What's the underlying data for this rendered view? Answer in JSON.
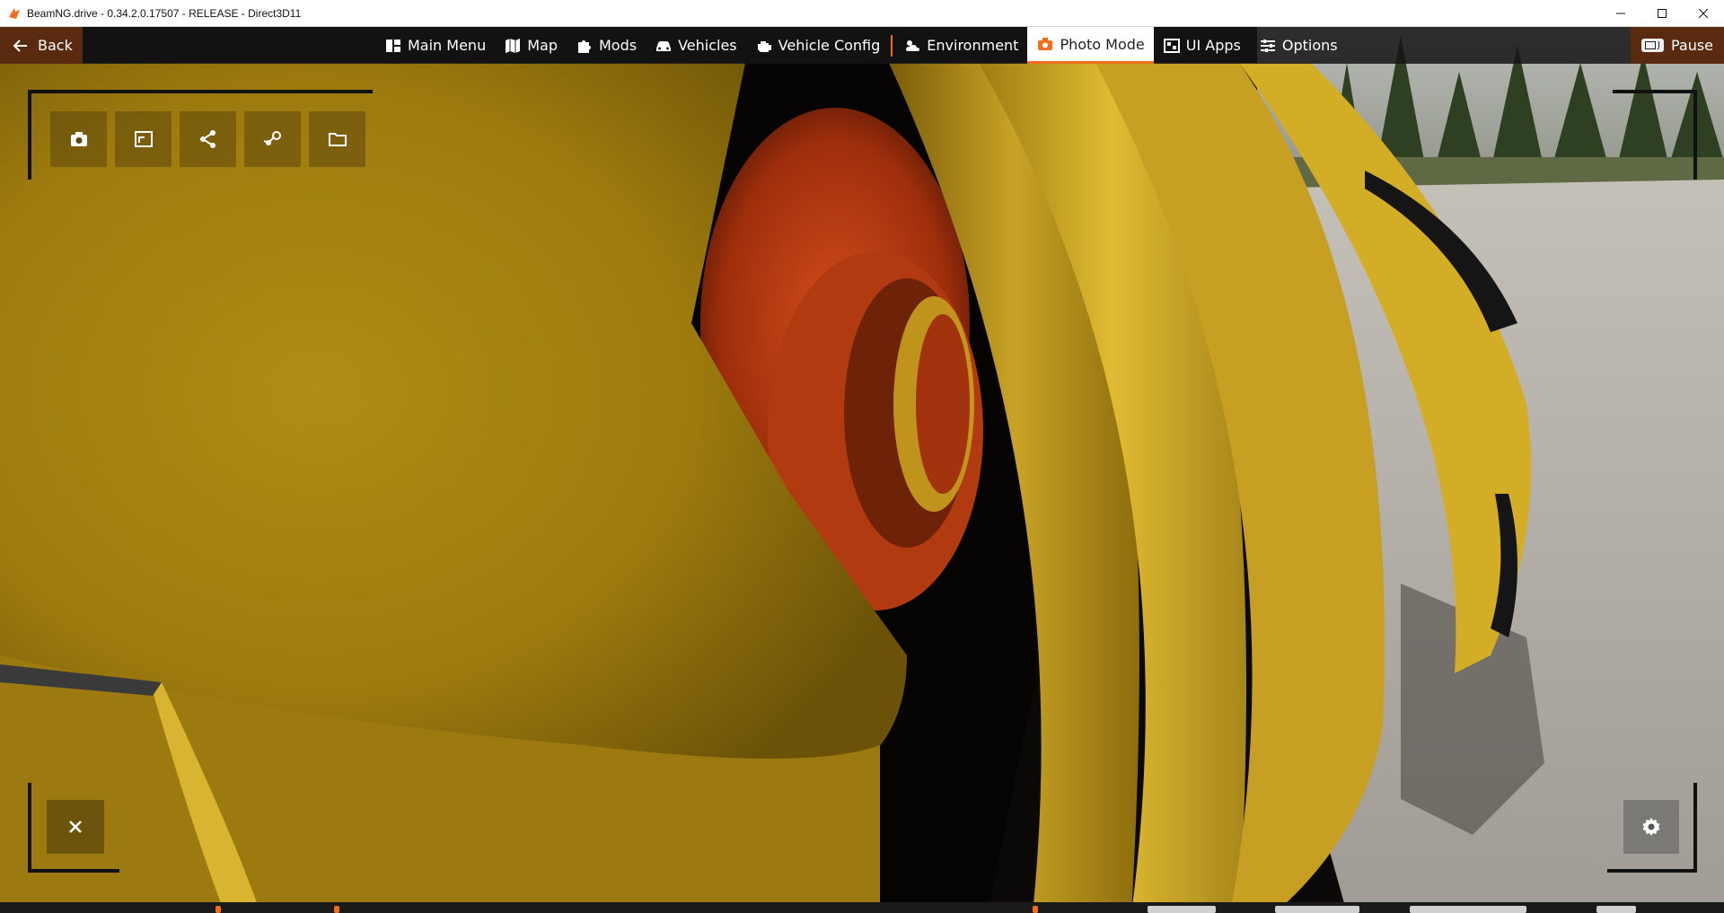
{
  "window": {
    "title": "BeamNG.drive - 0.34.2.0.17507 - RELEASE - Direct3D11",
    "controls": [
      "minimize-icon",
      "maximize-icon",
      "close-icon"
    ]
  },
  "menubar": {
    "back_label": "Back",
    "items": [
      {
        "label": "Main Menu",
        "icon": "main-menu-icon"
      },
      {
        "label": "Map",
        "icon": "map-icon"
      },
      {
        "label": "Mods",
        "icon": "puzzle-icon"
      },
      {
        "label": "Vehicles",
        "icon": "car-icon"
      },
      {
        "label": "Vehicle Config",
        "icon": "engine-icon"
      },
      {
        "label": "Environment",
        "icon": "weather-icon"
      },
      {
        "label": "Photo Mode",
        "icon": "camera-icon",
        "active": true
      },
      {
        "label": "UI Apps",
        "icon": "ui-apps-icon"
      },
      {
        "label": "Options",
        "icon": "sliders-icon"
      }
    ],
    "pause_key": "J",
    "pause_label": "Pause"
  },
  "photo_mode": {
    "tools": [
      "camera-icon",
      "fullscreen-icon",
      "share-icon",
      "steam-icon",
      "folder-icon"
    ],
    "close_icon": "close-icon",
    "settings_icon": "gear-icon"
  },
  "colors": {
    "accent": "#f06d1e",
    "back_bg": "#5a2a10",
    "yellow_body": "#c9a11c",
    "shock_orange": "#c4421a"
  }
}
